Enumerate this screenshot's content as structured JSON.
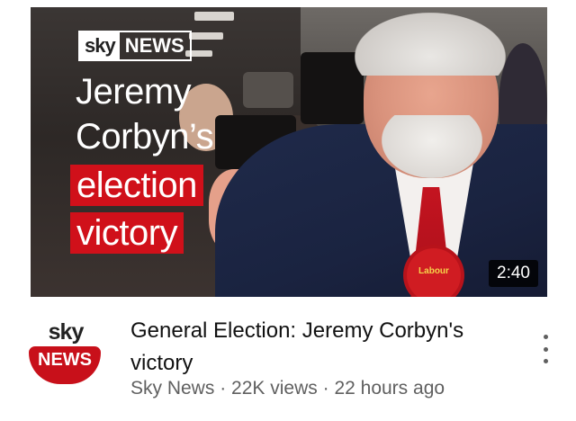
{
  "video": {
    "thumbnail": {
      "brand_sky": "sky",
      "brand_news": "NEWS",
      "headline_line1": "Jeremy",
      "headline_line2": "Corbyn’s",
      "headline_line3": "election",
      "headline_line4": "victory",
      "rosette_text": "Labour",
      "duration": "2:40"
    },
    "title": "General Election: Jeremy Corbyn's victory",
    "channel": "Sky News",
    "views": "22K views",
    "age": "22 hours ago",
    "separator": "·"
  },
  "channel_logo": {
    "sky": "sky",
    "news": "NEWS"
  },
  "colors": {
    "sky_red": "#d0101a",
    "meta_gray": "#606060"
  },
  "icons": {
    "more": "more-vertical-icon"
  }
}
